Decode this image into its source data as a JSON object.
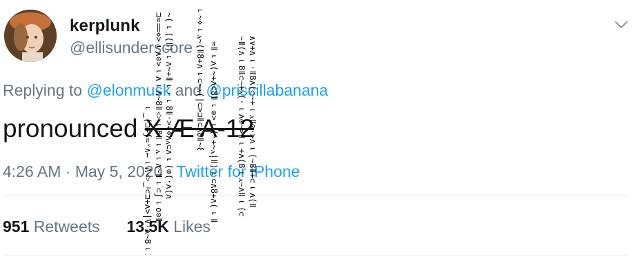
{
  "tweet": {
    "display_name": "kerplunk",
    "handle": "@ellisunderscore",
    "replying_prefix": "Replying to",
    "reply_to_1": "@elonmusk",
    "reply_and": "and",
    "reply_to_2": "@priscillabanana",
    "text_plain": "pronounced",
    "text_struck": "X Æ A-12",
    "time": "4:26 AM",
    "sep1": "·",
    "date": "May 5, 2020",
    "sep2": "·",
    "source": "Twitter for iPhone",
    "retweets_count": "951",
    "retweets_label": "Retweets",
    "likes_count": "13.5K",
    "likes_label": "Likes"
  },
  "icons": {
    "avatar": "portrait-avatar",
    "caret": "chevron-down-icon"
  },
  "colors": {
    "link": "#1da1f2",
    "secondary": "#657786",
    "primary": "#14171a",
    "divider": "#e1e8ed"
  },
  "glitch": {
    "col1": "⌐‿(⊐+ʃ≈ᵛ∧←⌐Ʌ◊‿ᵝ⊂⊐+ʌ>|V·ʌ~8⌐Ɨ>ᴧ⌐‿⟩⌐",
    "col2": "⊐≈‖⋄>⌐∧⊙>⌐ʌ⌐ʌ~8ǁ◊⌐8ǁ⌐ᴧ⌐ʌ~ǁ⌐⊂ʃ⌐o⊙ǁ",
    "col3": "~(⌐((ǁ⟩⌐ʌ~+ǁ⌐·⌐8ǁ·>+⋄ʌᴧ⊂ʌ⌐(⊙(·ʌ(ʌ",
    "col4": "⌐~⋄⌐ᴧ~(ǁ8+ʌ⌐⊂~ᴧ(|⊂>⊐ǁ⊂ʌ8ǁ~8+ʌ⌐⊙ʌ(",
    "col5": "≈ǁ⌐ʌ(~+ʌ⊂8ǁ⌐⊙>⌐(·+~ᴧ|ǁ⟩⌐⊂ʌ8+ʌ(⌐ǁ",
    "col6": "~ǁ(ʌ⌐8ǁ⊂~+ᴧ(·⌐ʌ⊙~>ǁ⌐+ʌ(8⌐ᴧ~ʌǁ⌐(⊂",
    "col7": "∧∨+ʌ⌐·ǁ8ʌ(⊂~+⌐ᴧǁ⊙·>ʌ⌐(~8ǁ+⊂⌐ʌ(ǁ"
  }
}
